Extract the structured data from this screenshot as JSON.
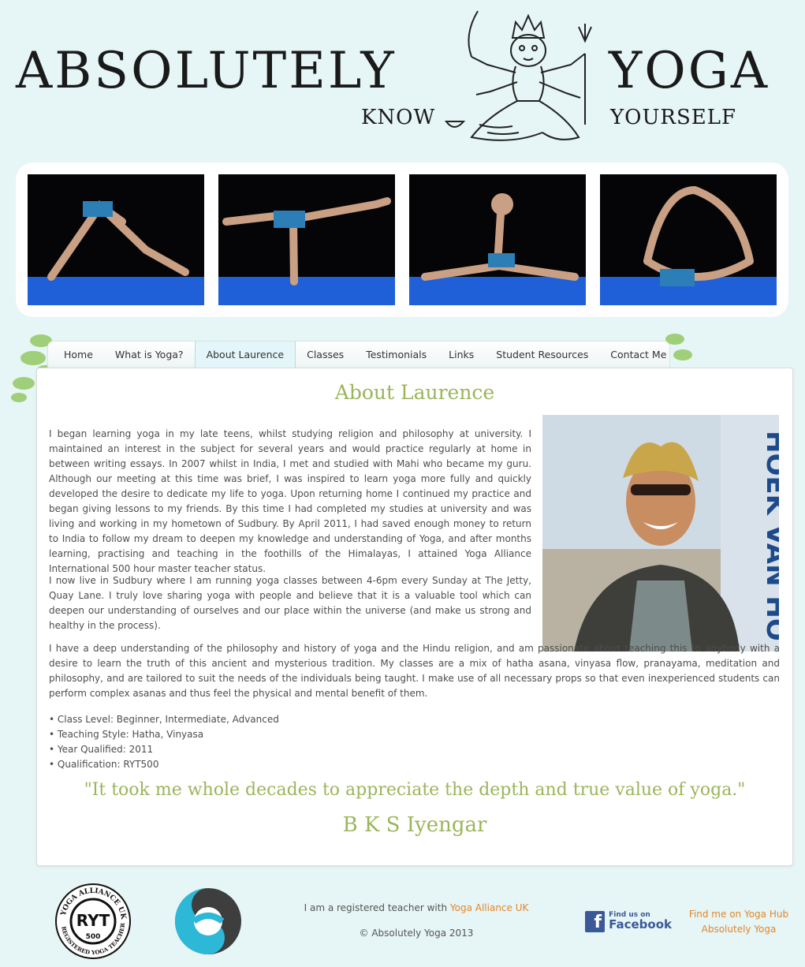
{
  "header": {
    "brand_left": "ABSOLUTELY",
    "brand_right": "YOGA",
    "tag_left": "KNOW",
    "tag_right": "YOURSELF",
    "logo_icon": "deity-illustration"
  },
  "banner": {
    "photos": [
      "downward-dog-pose",
      "warrior-three-pose",
      "splits-pose",
      "bow-pose"
    ]
  },
  "nav": {
    "items": [
      "Home",
      "What is Yoga?",
      "About Laurence",
      "Classes",
      "Testimonials",
      "Links",
      "Student Resources",
      "Contact Me"
    ],
    "active_index": 2
  },
  "page": {
    "title": "About Laurence",
    "paragraphs": [
      "I began learning yoga in my late teens, whilst studying religion and philosophy at university. I maintained an interest in the subject for several years and would practice regularly at home in between writing essays. In 2007 whilst in India, I met and studied with Mahi who became my guru. Although our meeting at this time was brief, I was inspired to learn yoga more fully and quickly developed the desire to dedicate my life to yoga. Upon returning home I continued my practice and began giving lessons to my friends. By this time I had completed my studies at university and was living and working in my hometown of Sudbury. By April 2011, I had saved enough money to return to India to follow my dream to deepen my knowledge and understanding of Yoga, and after months learning, practising and teaching in the foothills of the Himalayas, I attained Yoga Alliance International 500 hour master teacher status.",
      "I now live in Sudbury where I am running yoga classes between 4-6pm every Sunday at The Jetty, Quay Lane. I truly love sharing yoga with people and believe that it is a valuable tool which can deepen our understanding of ourselves and our place within the universe (and make us strong and healthy in the process).",
      "I have a deep understanding of the philosophy and history of yoga and the Hindu religion, and am passionate about teaching this to anybody with a desire to learn the truth of this ancient and mysterious tradition. My classes are a mix of hatha asana, vinyasa flow, pranayama, meditation and philosophy, and are tailored to suit the needs of the individuals being taught. I make use of all necessary props so that even inexperienced students can perform complex asanas and thus feel the physical and mental benefit of them."
    ],
    "facts": [
      "• Class Level: Beginner, Intermediate, Advanced",
      "• Teaching Style: Hatha, Vinyasa",
      "• Year Qualified: 2011",
      "• Qualification: RYT500"
    ],
    "portrait_sign": "HOEK VAN HO",
    "quote": "\"It took me whole decades to appreciate the depth and true value of yoga.\"",
    "quote_author": "B K S Iyengar"
  },
  "footer": {
    "badge_top": "YOGA ALLIANCE UK",
    "badge_center": "RYT",
    "badge_number": "500",
    "badge_bottom": "REGISTERED YOGA TEACHER",
    "registered_prefix": "I am a registered teacher with ",
    "registered_link": "Yoga Alliance UK",
    "copyright": "© Absolutely Yoga 2013",
    "facebook_small": "Find us on",
    "facebook_big": "Facebook",
    "yogahub_line1": "Find me on Yoga Hub",
    "yogahub_line2": "Absolutely Yoga"
  },
  "colors": {
    "background": "#e6f5f5",
    "accent_green": "#9bb55a",
    "link_orange": "#e3862a",
    "facebook_blue": "#3b5998",
    "mat_blue": "#1f5fd8"
  }
}
